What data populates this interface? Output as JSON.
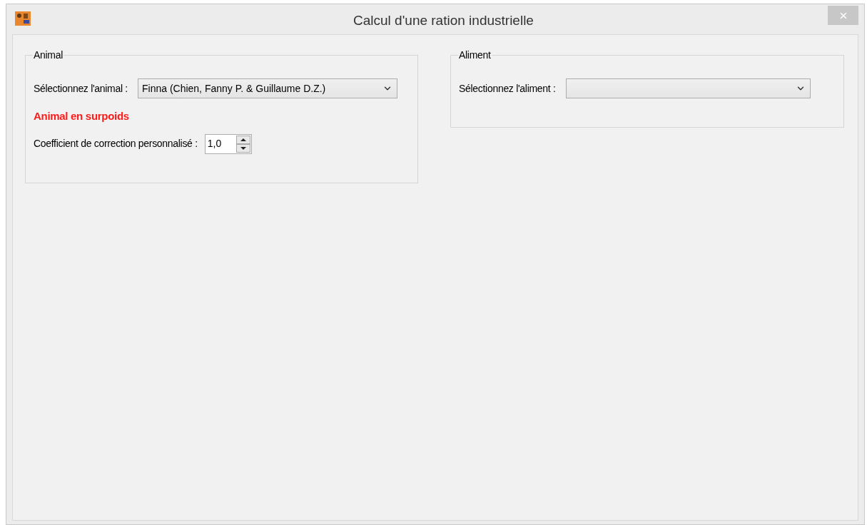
{
  "window": {
    "title": "Calcul d'une ration industrielle"
  },
  "animal_group": {
    "title": "Animal",
    "select_label": "Sélectionnez l'animal :",
    "select_value": "Finna (Chien, Fanny P. & Guillaume D.Z.)",
    "warning": "Animal en surpoids",
    "coefficient_label": "Coefficient de correction personnalisé :",
    "coefficient_value": "1,0"
  },
  "food_group": {
    "title": "Aliment",
    "select_label": "Sélectionnez l'aliment :"
  }
}
